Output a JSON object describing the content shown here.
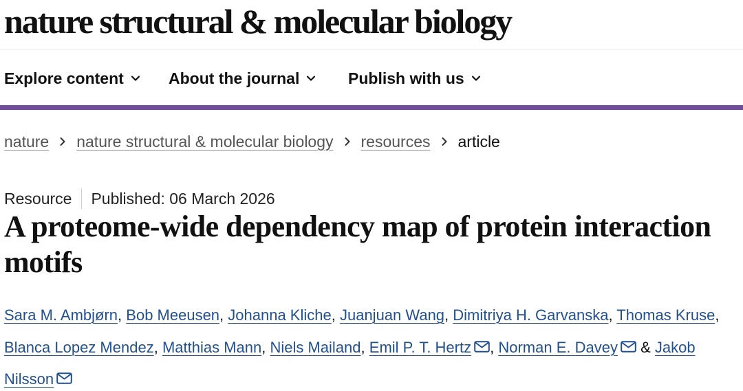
{
  "journal": {
    "name": "nature structural & molecular biology"
  },
  "nav": {
    "items": [
      {
        "label": "Explore content",
        "icon": "chevron-down-icon"
      },
      {
        "label": "About the journal",
        "icon": "chevron-down-icon"
      },
      {
        "label": "Publish with us",
        "icon": "chevron-down-icon"
      }
    ],
    "accent_color": "#6f4e9a"
  },
  "breadcrumb": {
    "items": [
      "nature",
      "nature structural & molecular biology",
      "resources"
    ],
    "current": "article",
    "separator_icon": "chevron-right-icon"
  },
  "article": {
    "type": "Resource",
    "published": "Published: 06 March 2026",
    "title": "A proteome-wide dependency map of protein interaction motifs",
    "authors": [
      {
        "name": "Sara M. Ambjørn"
      },
      {
        "name": "Bob Meeusen"
      },
      {
        "name": "Johanna Kliche"
      },
      {
        "name": "Juanjuan Wang"
      },
      {
        "name": "Dimitriya H. Garvanska"
      },
      {
        "name": "Thomas Kruse"
      },
      {
        "name": "Blanca Lopez Mendez"
      },
      {
        "name": "Matthias Mann"
      },
      {
        "name": "Niels Mailand"
      },
      {
        "name": "Emil P. T. Hertz",
        "contact": true
      },
      {
        "name": "Norman E. Davey",
        "contact": true
      },
      {
        "name": "Jakob Nilsson",
        "contact": true
      }
    ],
    "author_separator": ", ",
    "author_last_separator": " & ",
    "link_color": "#22508f",
    "contact_icon": "mail-icon"
  }
}
